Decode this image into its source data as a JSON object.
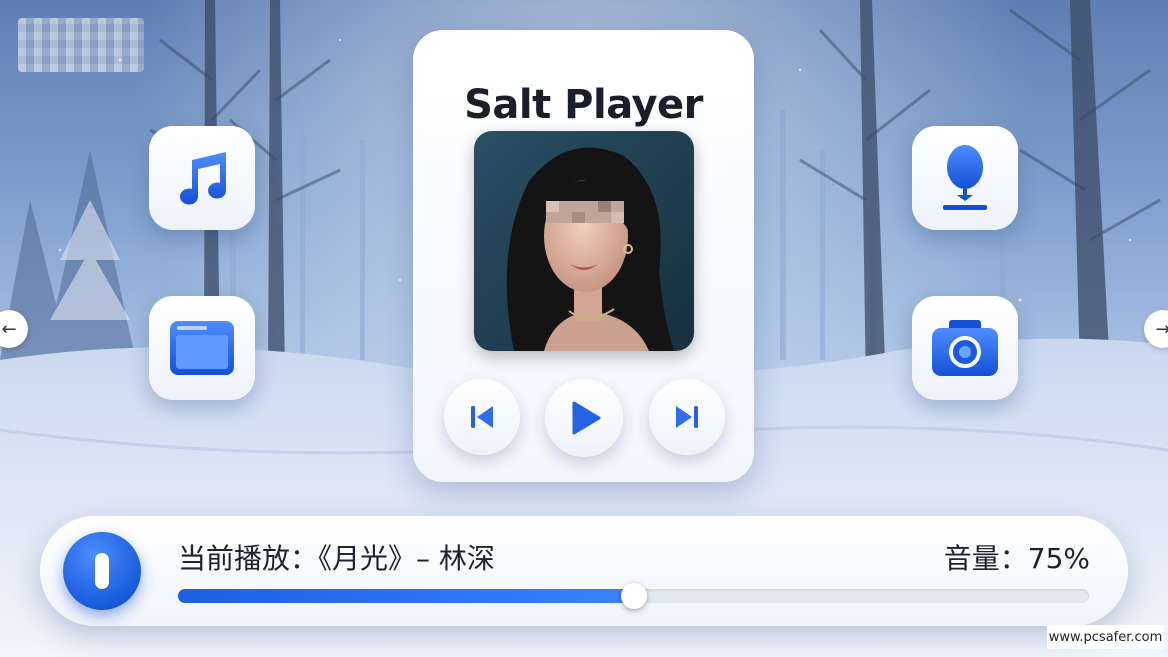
{
  "app": {
    "title": "Salt Player"
  },
  "player": {
    "controls": {
      "prev_icon": "skip-previous-icon",
      "play_icon": "play-icon",
      "next_icon": "skip-next-icon"
    }
  },
  "shortcuts": {
    "left": [
      {
        "icon": "music-note-icon"
      },
      {
        "icon": "window-icon"
      }
    ],
    "right": [
      {
        "icon": "microphone-icon"
      },
      {
        "icon": "camera-icon"
      }
    ]
  },
  "now_playing": {
    "label": "当前播放：《月光》– 林深",
    "volume_label": "音量：75%",
    "progress": 0.5,
    "pause_icon": "pause-icon"
  },
  "navigation": {
    "prev_arrow": "←",
    "next_arrow": "→"
  },
  "watermark": {
    "text": "www.pcsafer.com"
  },
  "colors": {
    "accent": "#2f6df0",
    "title": "#1a1e2b"
  }
}
